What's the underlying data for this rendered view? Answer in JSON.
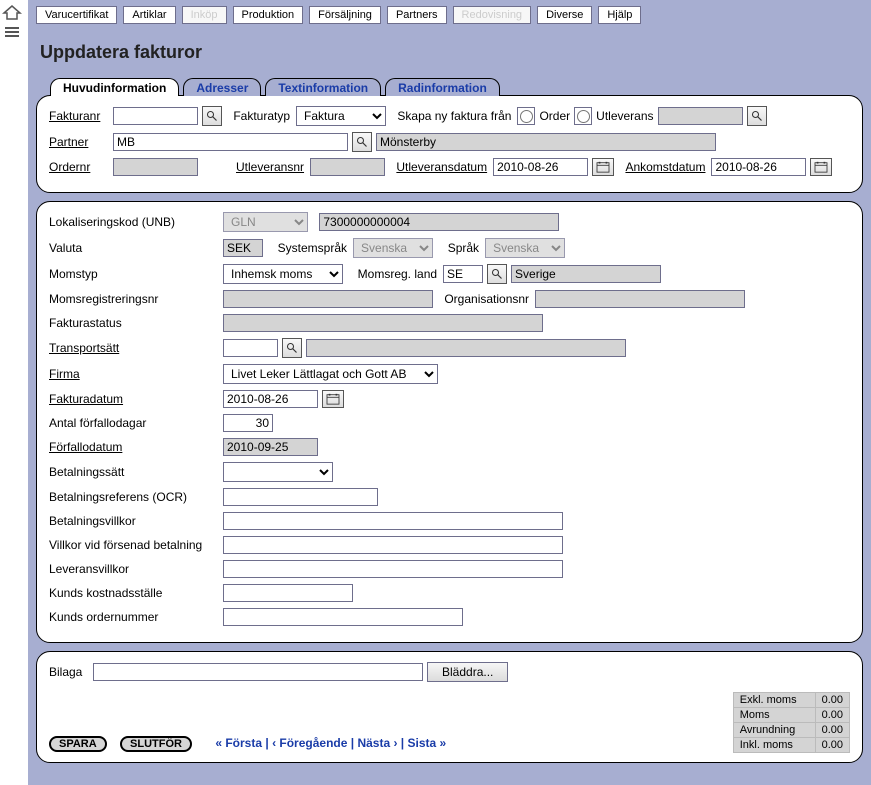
{
  "topbar": {
    "items": [
      {
        "label": "Varucertifikat",
        "disabled": false
      },
      {
        "label": "Artiklar",
        "disabled": false
      },
      {
        "label": "Inköp",
        "disabled": true
      },
      {
        "label": "Produktion",
        "disabled": false
      },
      {
        "label": "Försäljning",
        "disabled": false
      },
      {
        "label": "Partners",
        "disabled": false
      },
      {
        "label": "Redovisning",
        "disabled": true
      },
      {
        "label": "Diverse",
        "disabled": false
      },
      {
        "label": "Hjälp",
        "disabled": false
      }
    ]
  },
  "page": {
    "title": "Uppdatera fakturor"
  },
  "tabs": [
    {
      "label": "Huvudinformation",
      "active": true
    },
    {
      "label": "Adresser",
      "active": false
    },
    {
      "label": "Textinformation",
      "active": false
    },
    {
      "label": "Radinformation",
      "active": false
    }
  ],
  "header": {
    "fakturanr_label": "Fakturanr",
    "fakturanr_value": "",
    "fakturatyp_label": "Fakturatyp",
    "fakturatyp_value": "Faktura",
    "skapa_label": "Skapa ny faktura från",
    "radio_order": "Order",
    "radio_utleverans": "Utleverans",
    "source_value": "",
    "partner_label": "Partner",
    "partner_code": "MB",
    "partner_name": "Mönsterby",
    "ordernr_label": "Ordernr",
    "ordernr_value": "",
    "utleveransnr_label": "Utleveransnr",
    "utleveransnr_value": "",
    "utleveransdatum_label": "Utleveransdatum",
    "utleveransdatum_value": "2010-08-26",
    "ankomstdatum_label": "Ankomstdatum",
    "ankomstdatum_value": "2010-08-26"
  },
  "body": {
    "lokaliseringskod_label": "Lokaliseringskod (UNB)",
    "lokaliseringskod_type": "GLN",
    "lokaliseringskod_value": "7300000000004",
    "valuta_label": "Valuta",
    "valuta_value": "SEK",
    "systemsprak_label": "Systemspråk",
    "systemsprak_value": "Svenska",
    "sprak_label": "Språk",
    "sprak_value": "Svenska",
    "momstyp_label": "Momstyp",
    "momstyp_value": "Inhemsk moms",
    "momsreg_land_label": "Momsreg. land",
    "momsreg_land_code": "SE",
    "momsreg_land_name": "Sverige",
    "momsregistreringsnr_label": "Momsregistreringsnr",
    "momsregistreringsnr_value": "",
    "organisationsnr_label": "Organisationsnr",
    "organisationsnr_value": "",
    "fakturastatus_label": "Fakturastatus",
    "fakturastatus_value": "",
    "transportsatt_label": "Transportsätt",
    "transportsatt_code": "",
    "transportsatt_name": "",
    "firma_label": "Firma",
    "firma_value": "Livet Leker Lättlagat och Gott AB",
    "fakturadatum_label": "Fakturadatum",
    "fakturadatum_value": "2010-08-26",
    "antal_forfallodagar_label": "Antal förfallodagar",
    "antal_forfallodagar_value": "30",
    "forfallodatum_label": "Förfallodatum",
    "forfallodatum_value": "2010-09-25",
    "betalningssatt_label": "Betalningssätt",
    "betalningssatt_value": "",
    "betalningsreferens_label": "Betalningsreferens (OCR)",
    "betalningsreferens_value": "",
    "betalningsvillkor_label": "Betalningsvillkor",
    "betalningsvillkor_value": "",
    "villkor_forsenad_label": "Villkor vid försenad betalning",
    "villkor_forsenad_value": "",
    "leveransvillkor_label": "Leveransvillkor",
    "leveransvillkor_value": "",
    "kunds_kostnadsstalle_label": "Kunds kostnadsställe",
    "kunds_kostnadsstalle_value": "",
    "kunds_ordernummer_label": "Kunds ordernummer",
    "kunds_ordernummer_value": ""
  },
  "attachment": {
    "bilaga_label": "Bilaga",
    "bilaga_value": "",
    "browse_label": "Bläddra..."
  },
  "actions": {
    "save": "SPARA",
    "complete": "SLUTFÖR",
    "first": "« Första",
    "prev": "‹ Föregående",
    "next": "Nästa ›",
    "last": "Sista »"
  },
  "totals": {
    "exkl_moms_label": "Exkl. moms",
    "exkl_moms_value": "0.00",
    "moms_label": "Moms",
    "moms_value": "0.00",
    "avrundning_label": "Avrundning",
    "avrundning_value": "0.00",
    "inkl_moms_label": "Inkl. moms",
    "inkl_moms_value": "0.00"
  }
}
